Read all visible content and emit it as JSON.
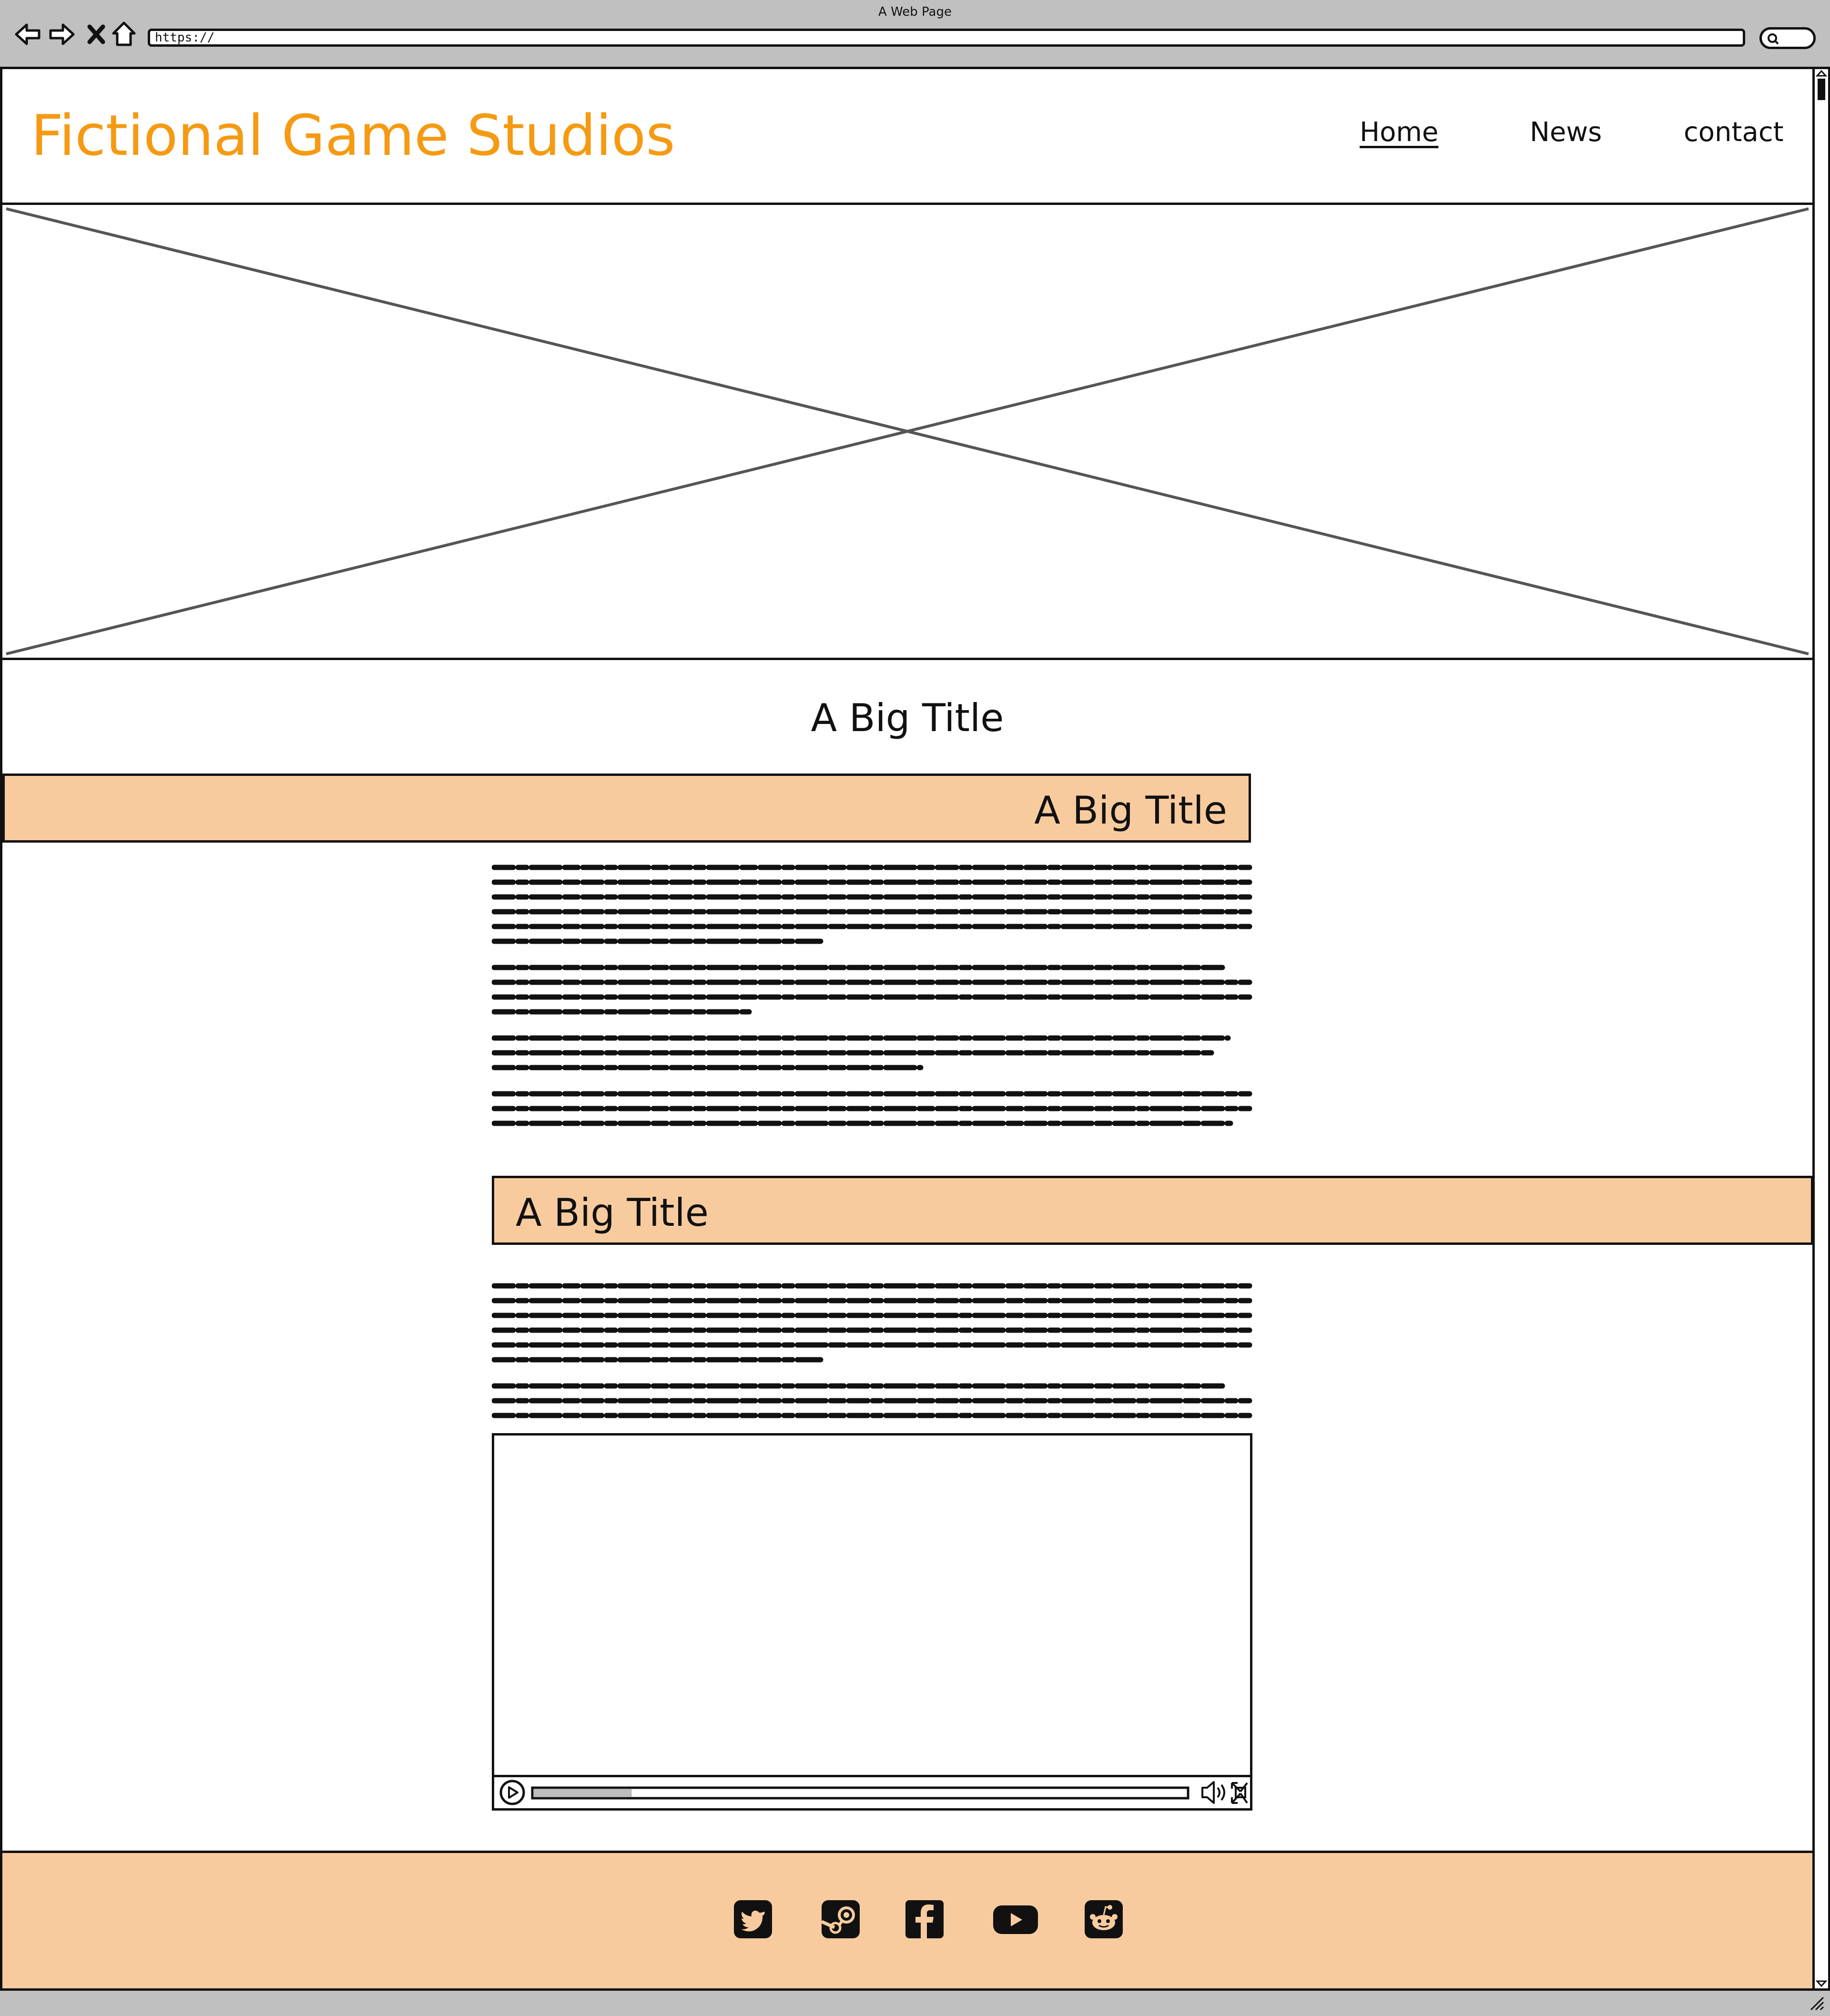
{
  "window": {
    "title": "A Web Page",
    "url": "https://"
  },
  "header": {
    "brand": "Fictional Game Studios",
    "nav": [
      {
        "label": "Home"
      },
      {
        "label": "News"
      },
      {
        "label": "contact"
      }
    ]
  },
  "hero": {
    "icon": "image-placeholder-icon"
  },
  "main": {
    "title": "A Big Title",
    "sections": [
      {
        "title": "A Big Title"
      },
      {
        "title": "A Big Title"
      }
    ],
    "video": {
      "progress": 0.15
    }
  },
  "footer": {
    "social_icons": [
      "twitter-icon",
      "steam-icon",
      "facebook-icon",
      "youtube-icon",
      "reddit-icon"
    ]
  },
  "colors": {
    "brand": "#f59a12",
    "band": "#f8cb9e",
    "chrome": "#c0c0c0",
    "ink": "#111111"
  }
}
